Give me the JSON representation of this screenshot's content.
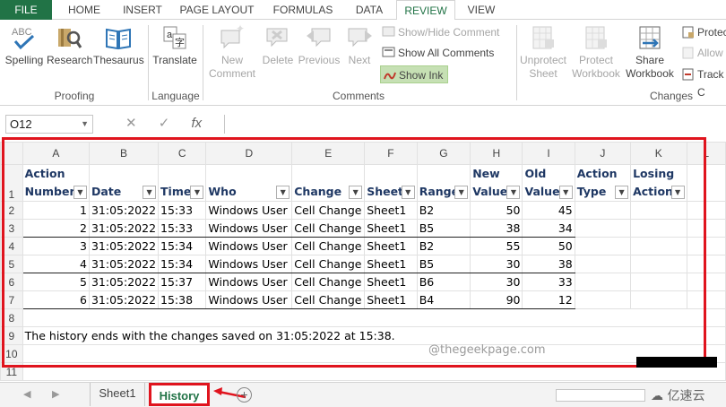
{
  "tabs": [
    "FILE",
    "HOME",
    "INSERT",
    "PAGE LAYOUT",
    "FORMULAS",
    "DATA",
    "REVIEW",
    "VIEW"
  ],
  "ribbon": {
    "proofing": {
      "spelling": "Spelling",
      "research": "Research",
      "thesaurus": "Thesaurus",
      "group": "Proofing"
    },
    "language": {
      "translate": "Translate",
      "group": "Language"
    },
    "comments": {
      "new_comment": "New Comment",
      "delete": "Delete",
      "previous": "Previous",
      "next": "Next",
      "show_hide": "Show/Hide Comment",
      "show_all": "Show All Comments",
      "show_ink": "Show Ink",
      "group": "Comments"
    },
    "changes": {
      "unprotect_sheet": "Unprotect Sheet",
      "protect_workbook": "Protect Workbook",
      "share_workbook": "Share Workbook",
      "protect": "Protec",
      "allow": "Allow",
      "track": "Track C",
      "group": "Changes"
    }
  },
  "formula_bar": {
    "name_box": "O12",
    "cancel": "✕",
    "enter": "✓",
    "fx": "fx"
  },
  "columns": [
    "A",
    "B",
    "C",
    "D",
    "E",
    "F",
    "G",
    "H",
    "I",
    "J",
    "K",
    "L"
  ],
  "headers": {
    "a1": "Action",
    "a2": "Number",
    "date": "Date",
    "time": "Time",
    "who": "Who",
    "change": "Change",
    "sheet": "Sheet",
    "range": "Range",
    "nv1": "New",
    "nv2": "Value",
    "ov1": "Old",
    "ov2": "Value",
    "at1": "Action",
    "at2": "Type",
    "la1": "Losing",
    "la2": "Action"
  },
  "rows": [
    {
      "n": "1",
      "date": "31:05:2022",
      "time": "15:33",
      "who": "Windows User",
      "change": "Cell Change",
      "sheet": "Sheet1",
      "range": "B2",
      "new": "50",
      "old": "45"
    },
    {
      "n": "2",
      "date": "31:05:2022",
      "time": "15:33",
      "who": "Windows User",
      "change": "Cell Change",
      "sheet": "Sheet1",
      "range": "B5",
      "new": "38",
      "old": "34"
    },
    {
      "n": "3",
      "date": "31:05:2022",
      "time": "15:34",
      "who": "Windows User",
      "change": "Cell Change",
      "sheet": "Sheet1",
      "range": "B2",
      "new": "55",
      "old": "50"
    },
    {
      "n": "4",
      "date": "31:05:2022",
      "time": "15:34",
      "who": "Windows User",
      "change": "Cell Change",
      "sheet": "Sheet1",
      "range": "B5",
      "new": "30",
      "old": "38"
    },
    {
      "n": "5",
      "date": "31:05:2022",
      "time": "15:37",
      "who": "Windows User",
      "change": "Cell Change",
      "sheet": "Sheet1",
      "range": "B6",
      "new": "30",
      "old": "33"
    },
    {
      "n": "6",
      "date": "31:05:2022",
      "time": "15:38",
      "who": "Windows User",
      "change": "Cell Change",
      "sheet": "Sheet1",
      "range": "B4",
      "new": "90",
      "old": "12"
    }
  ],
  "footer_note": "The history ends with the changes saved on 31:05:2022 at 15:38.",
  "watermark": "@thegeekpage.com",
  "sheet_tabs": [
    "Sheet1",
    "History"
  ],
  "logo_text": "亿速云",
  "colors": {
    "excel_green": "#217346",
    "highlight_red": "#e0141e",
    "header_text": "#1f3864"
  }
}
